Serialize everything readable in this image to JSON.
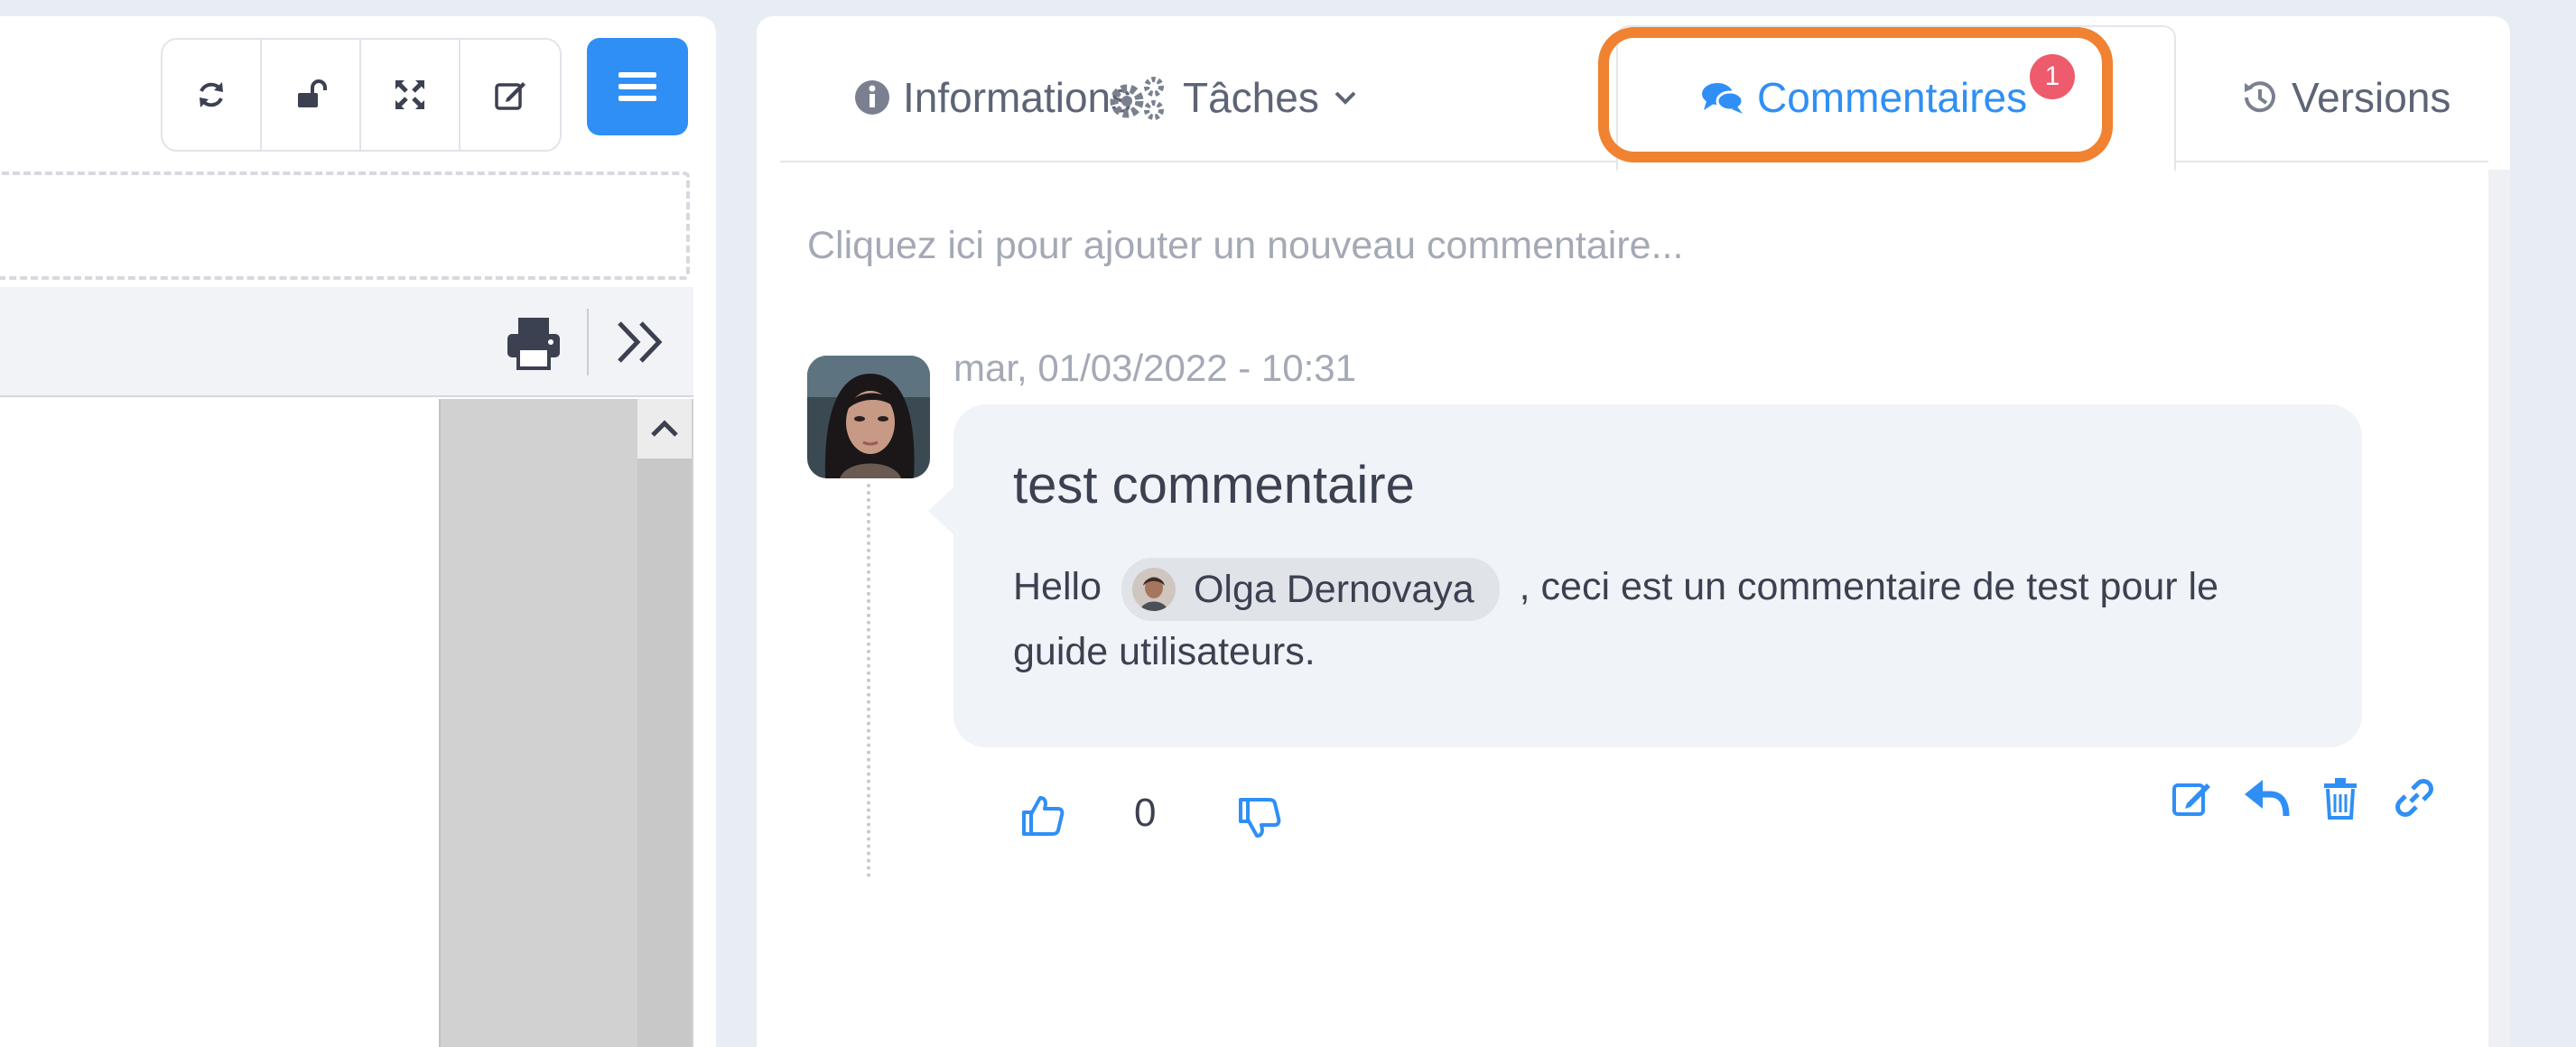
{
  "left_toolbar": {
    "icons": [
      "refresh-icon",
      "unlock-icon",
      "fullscreen-icon",
      "edit-icon"
    ],
    "menu_icon": "hamburger-menu-icon",
    "accent_color": "#2f8ff5"
  },
  "doc_toolbar": {
    "icons": [
      "print-icon",
      "expand-right-icon"
    ]
  },
  "tabs": [
    {
      "label": "Informations",
      "icon": "info-circle-icon"
    },
    {
      "label": "Tâches",
      "icon": "cogs-icon"
    },
    {
      "label": "Commentaires",
      "icon": "comments-icon",
      "badge": "1",
      "active": true
    },
    {
      "label": "Versions",
      "icon": "history-icon"
    }
  ],
  "highlight_color": "#f08232",
  "add_comment_placeholder": "Cliquez ici pour ajouter un nouveau commentaire...",
  "comment": {
    "date": "mar, 01/03/2022 - 10:31",
    "title": "test commentaire",
    "body_before": "Hello",
    "mention": "Olga Dernovaya",
    "body_after": ", ceci est un commentaire de test pour le guide utilisateurs.",
    "votes": "0",
    "actions": [
      "edit-icon",
      "reply-icon",
      "trash-icon",
      "link-icon"
    ]
  }
}
